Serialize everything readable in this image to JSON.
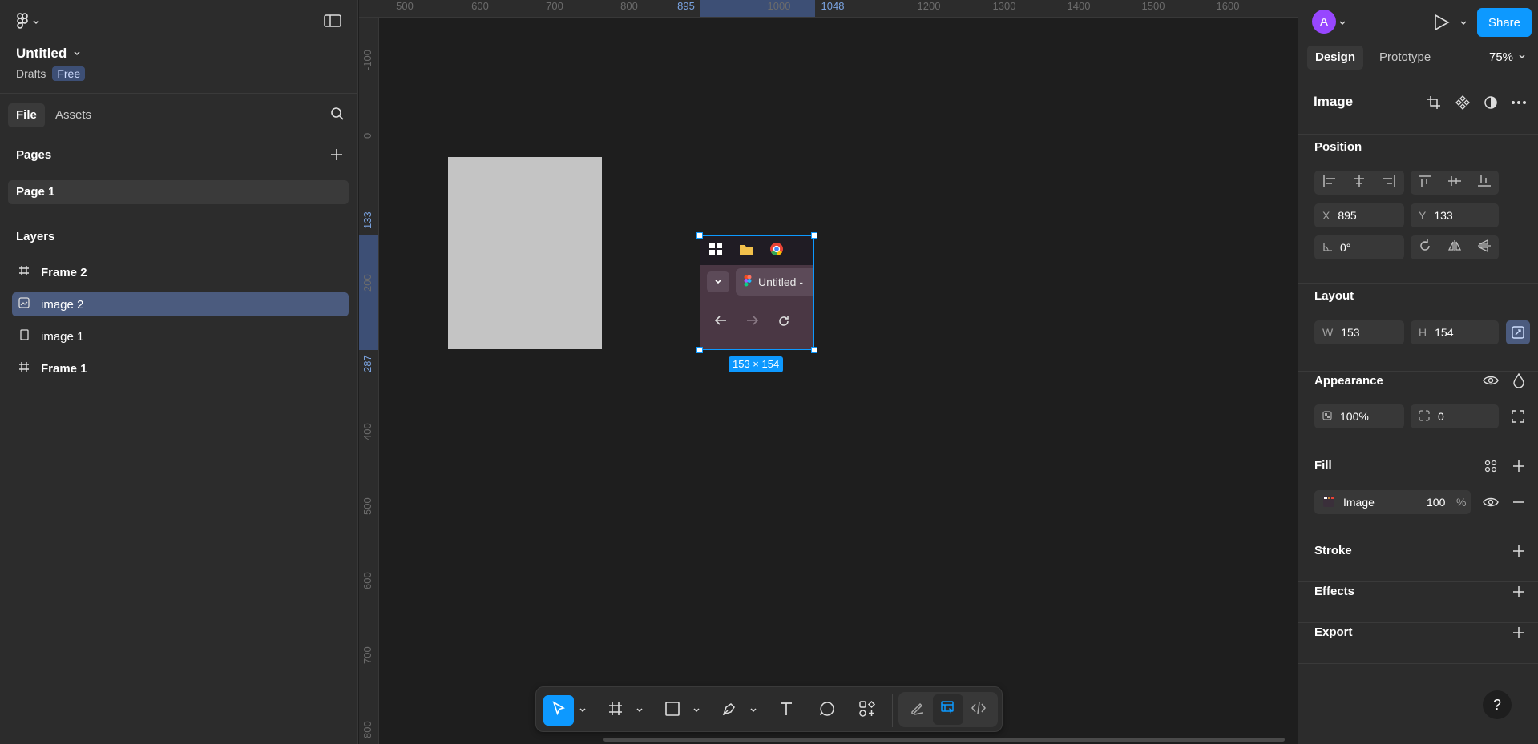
{
  "file": {
    "title": "Untitled",
    "location": "Drafts",
    "plan": "Free"
  },
  "left_tabs": {
    "file": "File",
    "assets": "Assets"
  },
  "pages": {
    "label": "Pages",
    "items": [
      "Page 1"
    ]
  },
  "layers": {
    "label": "Layers",
    "items": [
      {
        "name": "Frame 2",
        "icon": "frame-icon",
        "selected": false
      },
      {
        "name": "image 2",
        "icon": "image-icon",
        "selected": true
      },
      {
        "name": "image 1",
        "icon": "rectangle-icon",
        "selected": false
      },
      {
        "name": "Frame 1",
        "icon": "frame-icon",
        "selected": false
      }
    ]
  },
  "ruler_top": {
    "labels": [
      "500",
      "600",
      "700",
      "800",
      "895",
      "1000",
      "1048",
      "1200",
      "1300",
      "1400",
      "1500",
      "1600"
    ]
  },
  "ruler_left": {
    "labels": [
      "-100",
      "0",
      "133",
      "200",
      "287",
      "400",
      "500",
      "600",
      "700",
      "800"
    ]
  },
  "canvas": {
    "selection_size": "153 × 154",
    "embedded_shot": {
      "tab_title": "Untitled -"
    }
  },
  "header": {
    "avatar_initial": "A",
    "share_label": "Share"
  },
  "right_tabs": {
    "design": "Design",
    "prototype": "Prototype",
    "zoom": "75%"
  },
  "selection": {
    "title": "Image"
  },
  "position": {
    "label": "Position",
    "x_label": "X",
    "x": "895",
    "y_label": "Y",
    "y": "133",
    "rotation": "0°"
  },
  "layout": {
    "label": "Layout",
    "w_label": "W",
    "w": "153",
    "h_label": "H",
    "h": "154"
  },
  "appearance": {
    "label": "Appearance",
    "opacity": "100%",
    "radius": "0"
  },
  "fill": {
    "label": "Fill",
    "type": "Image",
    "opacity": "100",
    "unit": "%"
  },
  "stroke": {
    "label": "Stroke"
  },
  "effects": {
    "label": "Effects"
  },
  "export": {
    "label": "Export"
  },
  "help": {
    "label": "?"
  },
  "colors": {
    "accent": "#0d99ff",
    "panel": "#2c2c2c",
    "canvas": "#1e1e1e",
    "selected_layer": "#4b5b7e"
  }
}
